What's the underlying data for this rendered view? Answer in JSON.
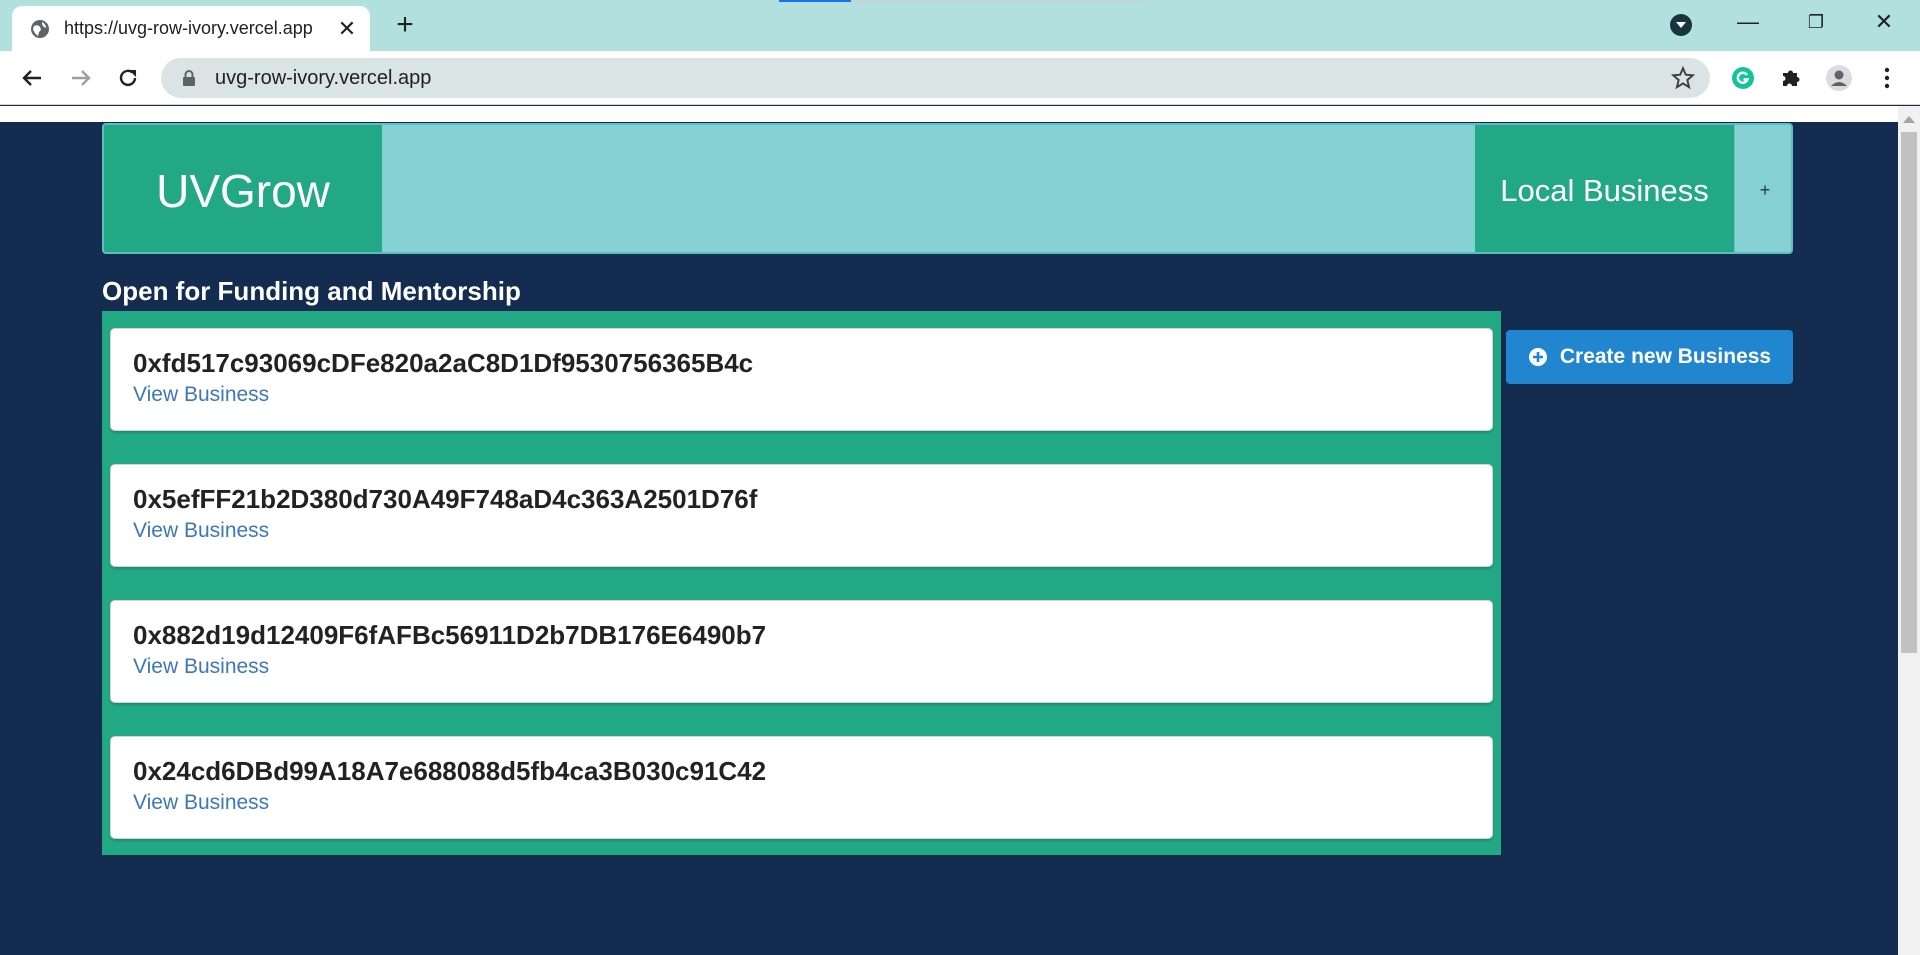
{
  "browser": {
    "tab_title": "https://uvg-row-ivory.vercel.app",
    "tab_close": "✕",
    "new_tab": "+",
    "url": "uvg-row-ivory.vercel.app",
    "window_controls": {
      "minimize": "—",
      "restore": "❐",
      "close": "✕"
    }
  },
  "header": {
    "brand": "UVGrow",
    "nav_local_business": "Local Business",
    "nav_plus": "+"
  },
  "main": {
    "section_title": "Open for Funding and Mentorship",
    "businesses": [
      {
        "address": "0xfd517c93069cDFe820a2aC8D1Df9530756365B4c",
        "link": "View Business"
      },
      {
        "address": "0x5efFF21b2D380d730A49F748aD4c363A2501D76f",
        "link": "View Business"
      },
      {
        "address": "0x882d19d12409F6fAFBc56911D2b7DB176E6490b7",
        "link": "View Business"
      },
      {
        "address": "0x24cd6DBd99A18A7e688088d5fb4ca3B030c91C42",
        "link": "View Business"
      }
    ],
    "create_button": "Create new Business"
  },
  "colors": {
    "page_bg": "#142c50",
    "header_bg": "#85d0d3",
    "accent_green": "#22a884",
    "button_blue": "#2185d0",
    "link_blue": "#3c78b8"
  },
  "icons": [
    "globe-icon",
    "back-arrow-icon",
    "forward-arrow-icon",
    "reload-icon",
    "lock-icon",
    "bookmark-star-icon",
    "grammarly-icon",
    "extensions-puzzle-icon",
    "profile-avatar-icon",
    "menu-kebab-icon",
    "plus-circle-icon"
  ]
}
